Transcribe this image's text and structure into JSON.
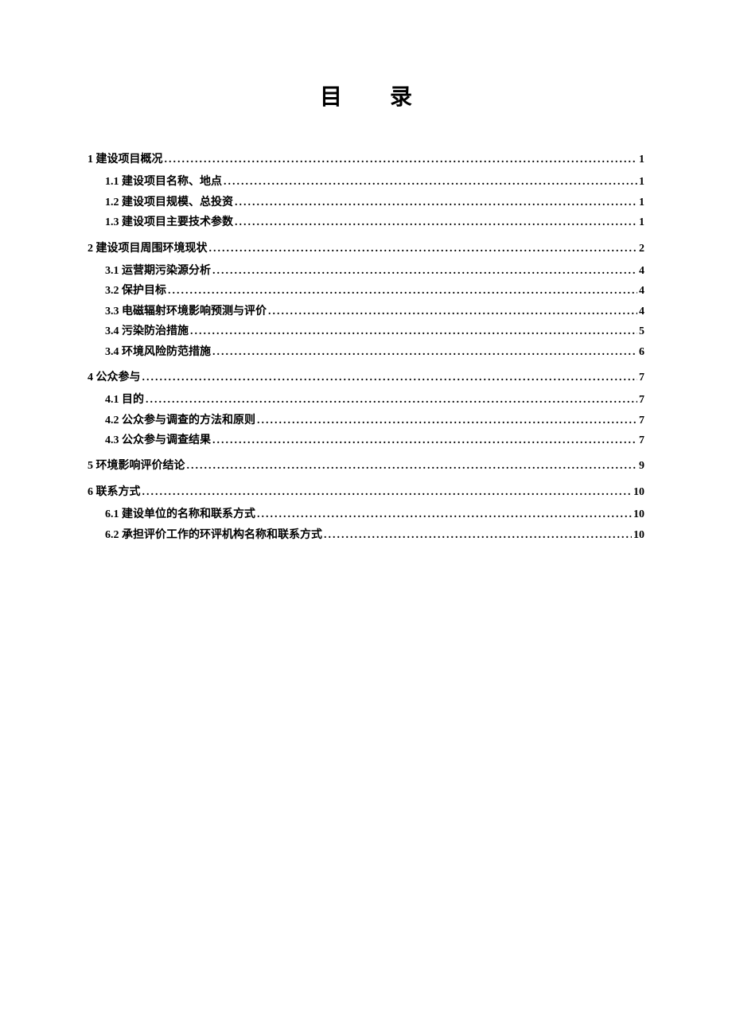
{
  "title": "目录",
  "toc": [
    {
      "level": 1,
      "label": "1 建设项目概况",
      "page": "1",
      "children": [
        {
          "level": 2,
          "label": "1.1 建设项目名称、地点",
          "page": "1"
        },
        {
          "level": 2,
          "label": "1.2  建设项目规模、总投资",
          "page": "1"
        },
        {
          "level": 2,
          "label": "1.3 建设项目主要技术参数",
          "page": "1"
        }
      ]
    },
    {
      "level": 1,
      "label": "2 建设项目周围环境现状",
      "page": "2",
      "children": [
        {
          "level": 2,
          "label": "3.1 运营期污染源分析",
          "page": "4"
        },
        {
          "level": 2,
          "label": "3.2 保护目标",
          "page": "4"
        },
        {
          "level": 2,
          "label": "3.3 电磁辐射环境影响预测与评价",
          "page": "4"
        },
        {
          "level": 2,
          "label": "3.4 污染防治措施",
          "page": "5"
        },
        {
          "level": 2,
          "label": "3.4 环境风险防范措施",
          "page": "6"
        }
      ]
    },
    {
      "level": 1,
      "label": "4 公众参与",
      "page": "7",
      "children": [
        {
          "level": 2,
          "label": "4.1 目的",
          "page": "7"
        },
        {
          "level": 2,
          "label": "4.2 公众参与调查的方法和原则",
          "page": "7"
        },
        {
          "level": 2,
          "label": "4.3 公众参与调查结果",
          "page": "7"
        }
      ]
    },
    {
      "level": 1,
      "label": "5 环境影响评价结论",
      "page": "9",
      "children": []
    },
    {
      "level": 1,
      "label": "6 联系方式",
      "page": "10",
      "children": [
        {
          "level": 2,
          "label": "6.1 建设单位的名称和联系方式",
          "page": "10"
        },
        {
          "level": 2,
          "label": "6.2 承担评价工作的环评机构名称和联系方式",
          "page": "10"
        }
      ]
    }
  ]
}
